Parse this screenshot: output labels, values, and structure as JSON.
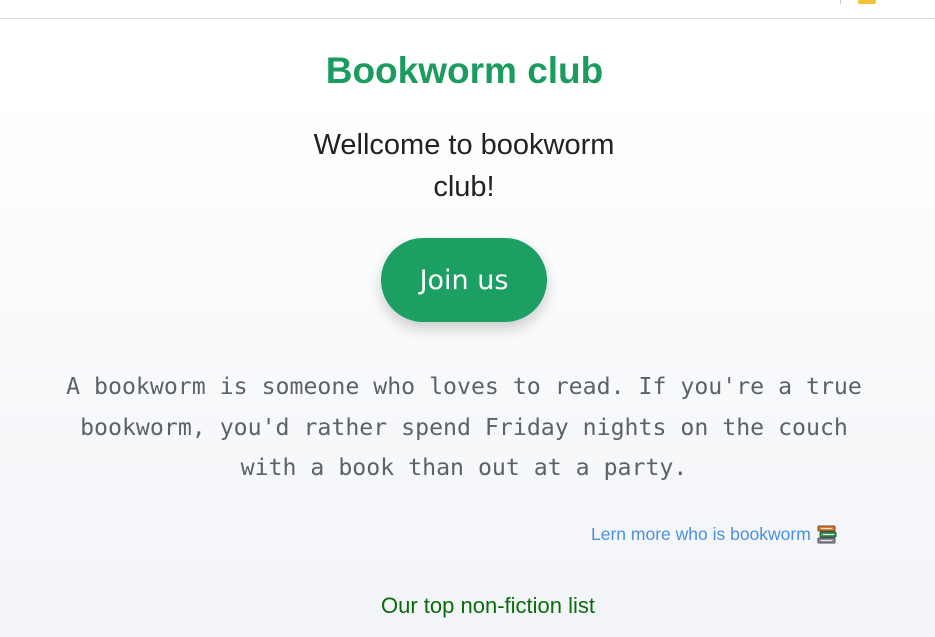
{
  "header": {
    "title": "Bookworm club"
  },
  "welcome": {
    "text": "Wellcome to bookworm club!"
  },
  "cta": {
    "join_label": "Join us"
  },
  "description": {
    "text": "A bookworm is someone who loves to read. If you're a true bookworm, you'd rather spend Friday nights on the couch with a book than out at a party."
  },
  "learn_more": {
    "label": "Lern more who is bookworm",
    "icon": "books-icon"
  },
  "sections": {
    "top_list_heading": "Our top non-fiction list"
  },
  "colors": {
    "brand_green": "#1c9b5f",
    "button_green": "#1c9f63",
    "link_blue": "#4a90e2",
    "heading_dark_green": "#0b6b0b",
    "body_gray": "#5d6168"
  }
}
